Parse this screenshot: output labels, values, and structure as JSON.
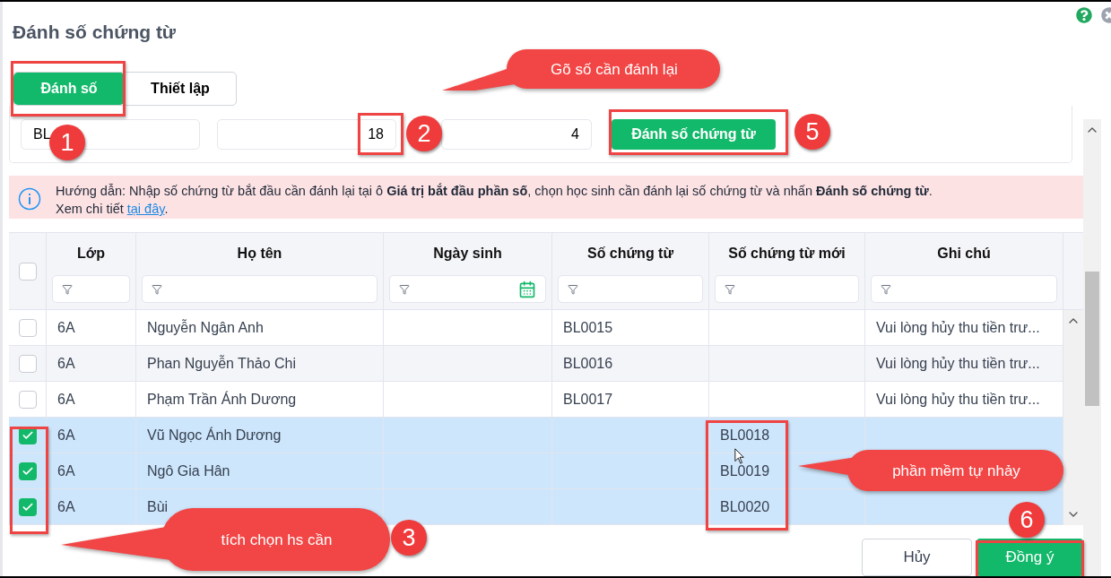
{
  "dialog": {
    "title": "Đánh số chứng từ"
  },
  "tabs": [
    {
      "label": "Đánh số",
      "selected": true
    },
    {
      "label": "Thiết lập",
      "selected": false
    }
  ],
  "fields": [
    {
      "value": "BL",
      "kind": "text"
    },
    {
      "value": "18",
      "kind": "number"
    },
    {
      "value": "4",
      "kind": "number"
    }
  ],
  "action_button": "Đánh số chứng từ",
  "info": {
    "text": "Hướng dẫn: Nhập số chứng từ bắt đầu cần đánh lại tại ô **Giá trị bắt đầu phần số**, chọn học sinh cần đánh lại số chứng từ và nhấn **Đánh số chứng từ**.",
    "more": "Xem chi tiết",
    "link": "tại đây",
    "end": "."
  },
  "table": {
    "header_checked": false,
    "columns": [
      {
        "label": "Lớp",
        "kind": "text"
      },
      {
        "label": "Họ tên",
        "kind": "text"
      },
      {
        "label": "Ngày sinh",
        "kind": "date"
      },
      {
        "label": "Số chứng từ",
        "kind": "text"
      },
      {
        "label": "Số chứng từ mới",
        "kind": "text"
      },
      {
        "label": "Ghi chú",
        "kind": "text"
      }
    ],
    "rows": [
      {
        "checked": false,
        "class": "6A",
        "name": "Nguyễn Ngân Anh",
        "voucher": "BL0015",
        "note": "Vui lòng hủy thu tiền trư..."
      },
      {
        "checked": false,
        "class": "6A",
        "name": "Phan Nguyễn Thảo Chi",
        "voucher": "BL0016",
        "note": "Vui lòng hủy thu tiền trư..."
      },
      {
        "checked": false,
        "class": "6A",
        "name": "Phạm Trần Ánh Dương",
        "voucher": "BL0017",
        "note": "Vui lòng hủy thu tiền trư..."
      },
      {
        "checked": true,
        "class": "6A",
        "name": "Vũ Ngọc Ánh Dương",
        "new_voucher": "BL0018"
      },
      {
        "checked": true,
        "class": "6A",
        "name": "Ngô Gia Hân",
        "new_voucher": "BL0019"
      },
      {
        "checked": true,
        "class": "6A",
        "name": "Bùi",
        "new_voucher": "BL0020"
      }
    ]
  },
  "buttons": [
    {
      "label": "Hủy",
      "kind": "secondary"
    },
    {
      "label": "Đồng ý",
      "kind": "primary"
    }
  ],
  "annotations": {
    "callouts": [
      {
        "text": "Gõ số cần đánh lại"
      },
      {
        "text": "tích chọn hs cần"
      },
      {
        "text": "phần mềm tự nhảy"
      }
    ],
    "badges": [
      {
        "number": "1"
      },
      {
        "number": "2"
      },
      {
        "number": "3"
      },
      {
        "number": "5"
      },
      {
        "number": "6"
      }
    ]
  }
}
